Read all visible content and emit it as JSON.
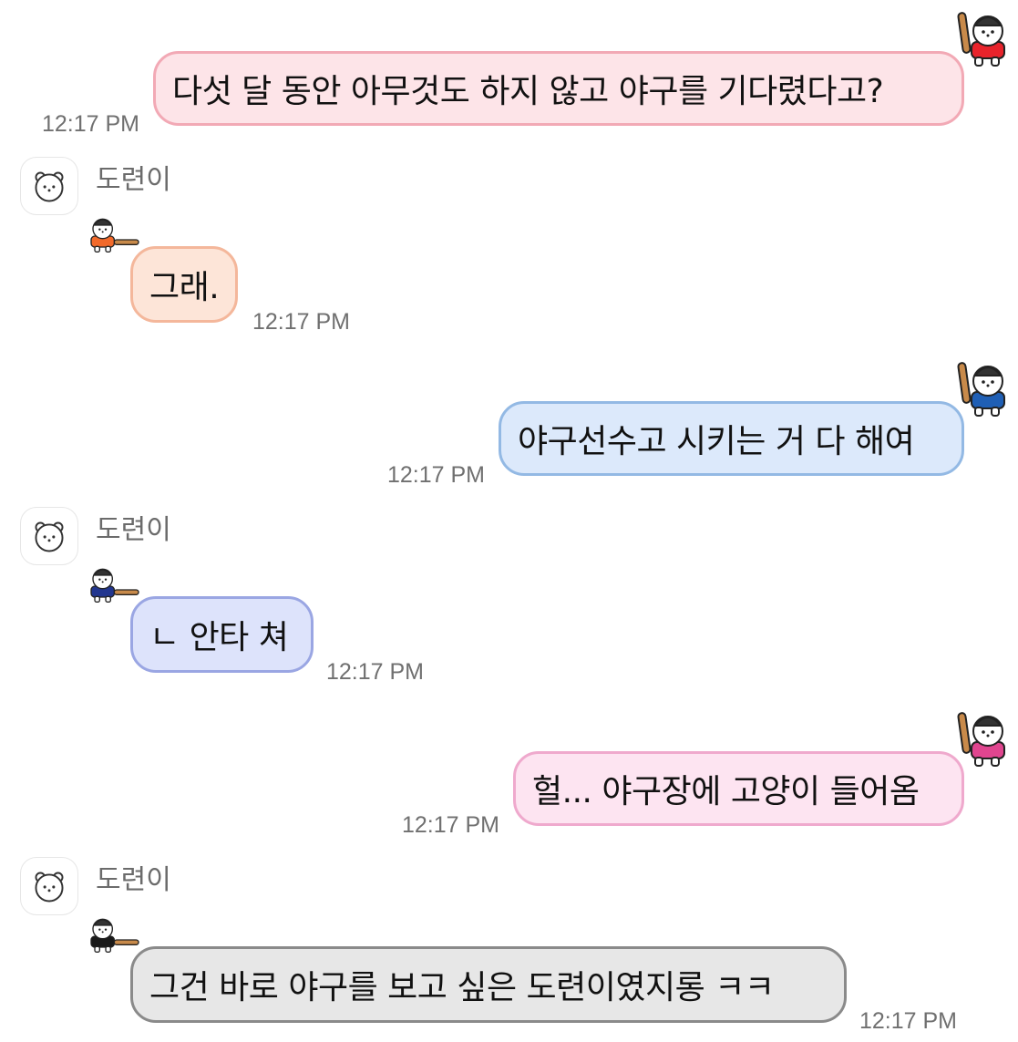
{
  "messages": [
    {
      "type": "sent",
      "text": "다섯 달 동안 아무것도 하지 않고 야구를 기다렸다고?",
      "time": "12:17 PM",
      "bubble_bg": "#fde4e8",
      "bubble_border": "#f2a9b5",
      "jersey": "#e8232b"
    },
    {
      "type": "received",
      "sender": "도련이",
      "text": "그래.",
      "time": "12:17 PM",
      "bubble_bg": "#fde5d8",
      "bubble_border": "#f4b79b",
      "jersey": "#f26a2b"
    },
    {
      "type": "sent",
      "text": "야구선수고 시키는 거 다 해여",
      "time": "12:17 PM",
      "bubble_bg": "#dce9fb",
      "bubble_border": "#93b9e4",
      "jersey": "#1f5fb5"
    },
    {
      "type": "received",
      "sender": "도련이",
      "text": "ㄴ 안타 쳐",
      "time": "12:17 PM",
      "bubble_bg": "#dde3fb",
      "bubble_border": "#9aa6e3",
      "jersey": "#22368f"
    },
    {
      "type": "sent",
      "text": "헐... 야구장에 고양이 들어옴",
      "time": "12:17 PM",
      "bubble_bg": "#fde4f1",
      "bubble_border": "#efa9cd",
      "jersey": "#e0458f"
    },
    {
      "type": "received",
      "sender": "도련이",
      "text": "그건 바로 야구를 보고 싶은 도련이였지롱 ㅋㅋ",
      "time": "12:17 PM",
      "bubble_bg": "#e7e7e7",
      "bubble_border": "#8a8a8a",
      "jersey": "#1a1a1a"
    }
  ],
  "icons": {
    "avatar": "bear-face-icon",
    "mascot": "bear-baseball-player-icon",
    "bat": "baseball-bat-icon"
  }
}
